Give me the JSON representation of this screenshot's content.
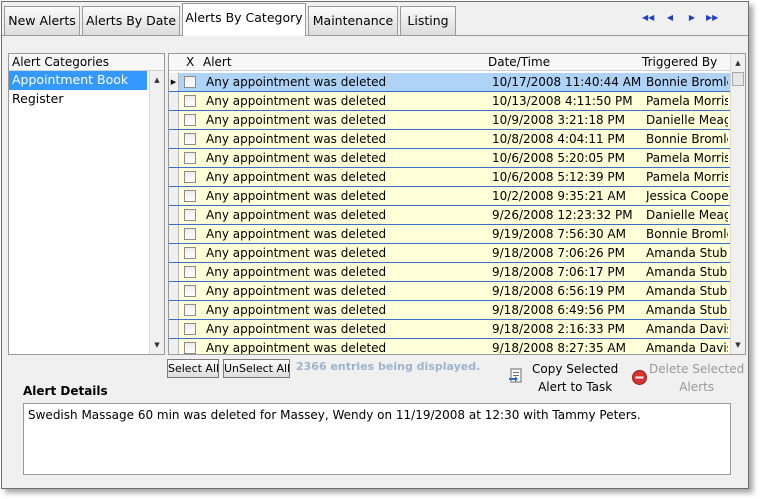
{
  "tabs": [
    {
      "label": "New Alerts"
    },
    {
      "label": "Alerts By Date"
    },
    {
      "label": "Alerts By Category"
    },
    {
      "label": "Maintenance"
    },
    {
      "label": "Listing"
    }
  ],
  "nav_icons": [
    "first-page-icon",
    "previous-page-icon",
    "next-page-icon",
    "last-page-icon"
  ],
  "categories": {
    "header": "Alert Categories",
    "items": [
      "Appointment Book",
      "Register"
    ]
  },
  "grid": {
    "columns": {
      "x": "X",
      "alert": "Alert",
      "date": "Date/Time",
      "by": "Triggered By"
    },
    "rows": [
      {
        "alert": "Any appointment was deleted",
        "date": "10/17/2008 11:40:44 AM",
        "by": "Bonnie Bromley"
      },
      {
        "alert": "Any appointment was deleted",
        "date": "10/13/2008 4:11:50 PM",
        "by": "Pamela Morris"
      },
      {
        "alert": "Any appointment was deleted",
        "date": "10/9/2008 3:21:18 PM",
        "by": "Danielle Meager"
      },
      {
        "alert": "Any appointment was deleted",
        "date": "10/8/2008 4:04:11 PM",
        "by": "Bonnie Bromley"
      },
      {
        "alert": "Any appointment was deleted",
        "date": "10/6/2008 5:20:05 PM",
        "by": "Pamela Morris"
      },
      {
        "alert": "Any appointment was deleted",
        "date": "10/6/2008 5:12:39 PM",
        "by": "Pamela Morris"
      },
      {
        "alert": "Any appointment was deleted",
        "date": "10/2/2008 9:35:21 AM",
        "by": "Jessica Cooper"
      },
      {
        "alert": "Any appointment was deleted",
        "date": "9/26/2008 12:23:32 PM",
        "by": "Danielle Meager"
      },
      {
        "alert": "Any appointment was deleted",
        "date": "9/19/2008 7:56:30 AM",
        "by": "Bonnie Bromley"
      },
      {
        "alert": "Any appointment was deleted",
        "date": "9/18/2008 7:06:26 PM",
        "by": "Amanda Stubbs"
      },
      {
        "alert": "Any appointment was deleted",
        "date": "9/18/2008 7:06:17 PM",
        "by": "Amanda Stubbs"
      },
      {
        "alert": "Any appointment was deleted",
        "date": "9/18/2008 6:56:19 PM",
        "by": "Amanda Stubbs"
      },
      {
        "alert": "Any appointment was deleted",
        "date": "9/18/2008 6:49:56 PM",
        "by": "Amanda Stubbs"
      },
      {
        "alert": "Any appointment was deleted",
        "date": "9/18/2008 2:16:33 PM",
        "by": "Amanda Davis"
      },
      {
        "alert": "Any appointment was deleted",
        "date": "9/18/2008 8:27:35 AM",
        "by": "Amanda Davis"
      }
    ]
  },
  "buttons": {
    "select_all": "Select All",
    "unselect_all": "UnSelect All"
  },
  "entries_text": "2366 entries being displayed.",
  "actions": {
    "copy_line1": "Copy Selected",
    "copy_line2": "Alert to Task",
    "delete_line1": "Delete Selected",
    "delete_line2": "Alerts"
  },
  "details": {
    "label": "Alert Details",
    "text": "Swedish Massage 60 min was deleted for Massey, Wendy on 11/19/2008 at 12:30 with Tammy Peters."
  },
  "colors": {
    "selection": "#3399ff",
    "row_background": "#ffffd8",
    "selected_row": "#aed3f7",
    "row_divider": "#3a6fc9"
  }
}
